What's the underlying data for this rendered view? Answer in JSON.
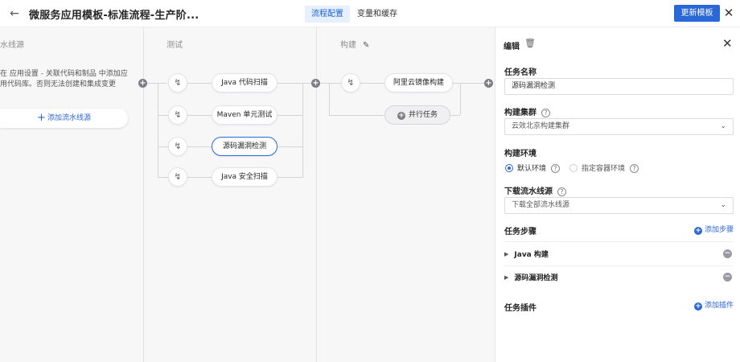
{
  "header": {
    "back_icon": "arrow-left-icon",
    "title": "微服务应用模板-标准流程-生产阶...",
    "tabs": [
      {
        "label": "流程配置",
        "active": true
      },
      {
        "label": "变量和缓存",
        "active": false
      }
    ],
    "update_label": "更新模板",
    "close_icon": "close-icon"
  },
  "colors": {
    "primary": "#2a67d8",
    "canvas_bg": "#f7f7f8",
    "selected_border": "#2a67d8",
    "tab_active_bg": "#e6f0ff"
  },
  "stages": {
    "source": {
      "title": "水线源",
      "desc_lines": [
        "在 应用设置 - 关联代码和制品 中添加应",
        "用代码库。否则无法创建和集成变更"
      ],
      "add_label": "添加流水线源"
    },
    "test": {
      "title": "测试",
      "jobs": [
        {
          "label": "Java 代码扫描",
          "selected": false
        },
        {
          "label": "Maven 单元测试",
          "selected": false
        },
        {
          "label": "源码漏洞检测",
          "selected": true
        },
        {
          "label": "Java 安全扫描",
          "selected": false
        }
      ]
    },
    "build": {
      "title": "构建",
      "edit_icon": "edit-icon",
      "jobs": [
        {
          "label": "阿里云镜像构建",
          "selected": false
        }
      ],
      "parallel_label": "并行任务"
    }
  },
  "panel": {
    "title": "编辑",
    "trash_icon": "trash-icon",
    "close_icon": "close-icon",
    "task_name": {
      "label": "任务名称",
      "value": "源码漏洞检测"
    },
    "build_cluster": {
      "label": "构建集群",
      "value": "云效北京构建集群"
    },
    "build_env": {
      "label": "构建环境",
      "options": [
        {
          "label": "默认环境",
          "checked": true
        },
        {
          "label": "指定容器环境",
          "checked": false
        }
      ]
    },
    "download_source": {
      "label": "下载流水线源",
      "value": "下载全部流水线源"
    },
    "task_steps": {
      "label": "任务步骤",
      "add_label": "添加步骤",
      "items": [
        {
          "label": "Java 构建"
        },
        {
          "label": "源码漏洞检测"
        }
      ]
    },
    "task_plugins": {
      "label": "任务插件",
      "add_label": "添加插件"
    }
  }
}
